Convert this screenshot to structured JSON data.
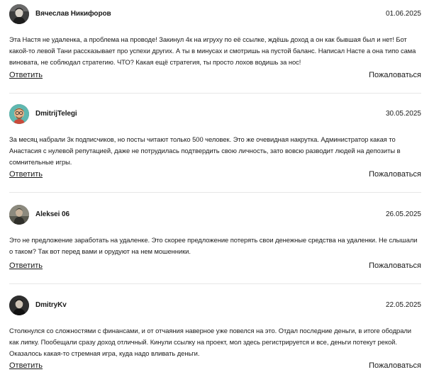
{
  "comments": [
    {
      "author": "Вячеслав Никифоров",
      "date": "01.06.2025",
      "text": "Эта Настя не удаленка, а проблема на проводе! Закинул 4к на игруху по её ссылке, ждёшь доход а он как бывшая был и нет! Бот какой-то левой Тани рассказывает про успехи других. А ты в минусах и смотришь на пустой баланс. Написал Насте а она типо сама виновата, не соблюдал стратегию. ЧТО? Какая ещё стратегия, ты просто лохов водишь за нос!",
      "reply_label": "Ответить",
      "complain_label": "Пожаловаться",
      "avatar_icon": "user-avatar-dark-photo"
    },
    {
      "author": "DmitrijTelegi",
      "date": "30.05.2025",
      "text": "За месяц набрали 3к подписчиков, но посты читают только 500 человек. Это же очевидная накрутка. Администратор какая то Анастасия с нулевой репутацией, даже не потрудилась подтвердить свою личность, зато вовсю разводит людей на депозиты в сомнительные игры.",
      "reply_label": "Ответить",
      "complain_label": "Пожаловаться",
      "avatar_icon": "user-avatar-cartoon"
    },
    {
      "author": "Aleksei 06",
      "date": "26.05.2025",
      "text": "Это не предложение заработать на удаленке. Это скорее предложение потерять свои денежные средства на удаленки. Не слышали о таком? Так вот перед вами и орудуют на нем мошенники.",
      "reply_label": "Ответить",
      "complain_label": "Пожаловаться",
      "avatar_icon": "user-avatar-photo"
    },
    {
      "author": "DmitryKv",
      "date": "22.05.2025",
      "text": "Столкнулся со сложностями с финансами, и от отчаяния наверное уже повелся на это. Отдал последние деньги, в итоге ободрали как липку. Пообещали сразу доход отличный. Кинули ссылку на проект, мол здесь регистрируется и все, деньги потекут рекой. Оказалось какая-то стремная игра, куда надо вливать деньги.",
      "reply_label": "Ответить",
      "complain_label": "Пожаловаться",
      "avatar_icon": "user-avatar-dark-photo"
    }
  ],
  "colors": {
    "text": "#1a1a1a",
    "divider": "#e6e6e6",
    "background": "#ffffff"
  }
}
